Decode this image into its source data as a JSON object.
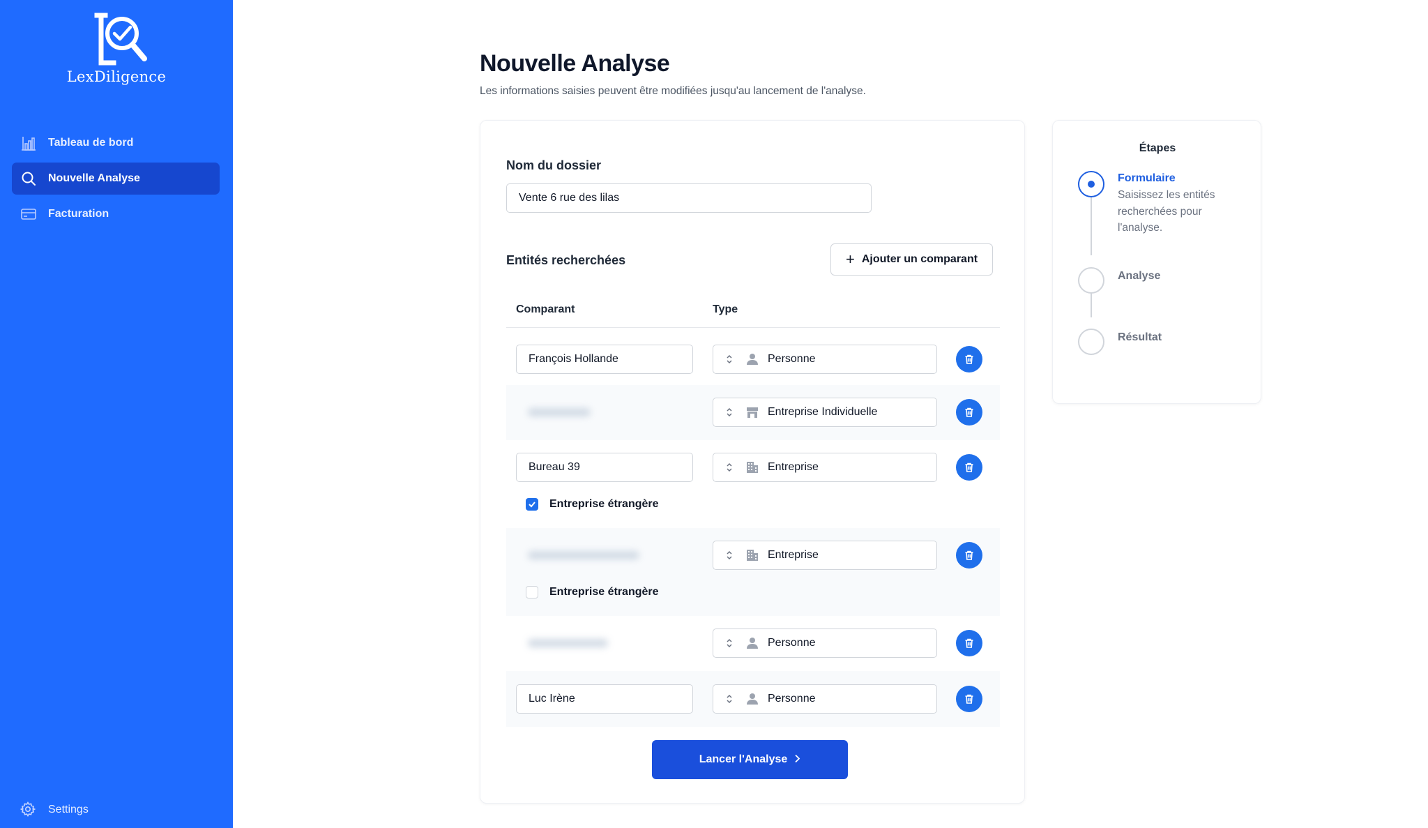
{
  "app": {
    "logo_text": "LexDiligence",
    "accent_color": "#1f6bff",
    "primary_button_color": "#1a4fdc"
  },
  "sidebar": {
    "items": [
      {
        "label": "Tableau de bord",
        "icon": "chart-icon",
        "active": false
      },
      {
        "label": "Nouvelle Analyse",
        "icon": "search-icon",
        "active": true
      },
      {
        "label": "Facturation",
        "icon": "credit-card-icon",
        "active": false
      }
    ],
    "settings_label": "Settings"
  },
  "header": {
    "title": "Nouvelle Analyse",
    "subtitle": "Les informations saisies peuvent être modifiées jusqu'au lancement de l'analyse."
  },
  "form": {
    "folder_label": "Nom du dossier",
    "folder_value": "Vente 6 rue des lilas",
    "entities_title": "Entités recherchées",
    "add_button_label": "Ajouter un comparant",
    "columns": [
      "Comparant",
      "Type"
    ],
    "rows": [
      {
        "name": "François Hollande",
        "type": "Personne",
        "type_icon": "person-icon"
      },
      {
        "name": "",
        "type": "Entreprise Individuelle",
        "type_icon": "storefront-icon"
      },
      {
        "name": "Bureau 39",
        "type": "Entreprise",
        "type_icon": "building-icon",
        "foreign_label": "Entreprise étrangère",
        "foreign_checked": true
      },
      {
        "name": "",
        "type": "Entreprise",
        "type_icon": "building-icon",
        "foreign_label": "Entreprise étrangère",
        "foreign_checked": false
      },
      {
        "name": "",
        "type": "Personne",
        "type_icon": "person-icon"
      },
      {
        "name": "Luc Irène",
        "type": "Personne",
        "type_icon": "person-icon"
      }
    ],
    "launch_button_label": "Lancer l'Analyse"
  },
  "steps": {
    "title": "Étapes",
    "items": [
      {
        "name": "Formulaire",
        "description": "Saisissez les entités recherchées pour l'analyse.",
        "status": "current"
      },
      {
        "name": "Analyse",
        "status": "upcoming"
      },
      {
        "name": "Résultat",
        "status": "upcoming"
      }
    ]
  }
}
